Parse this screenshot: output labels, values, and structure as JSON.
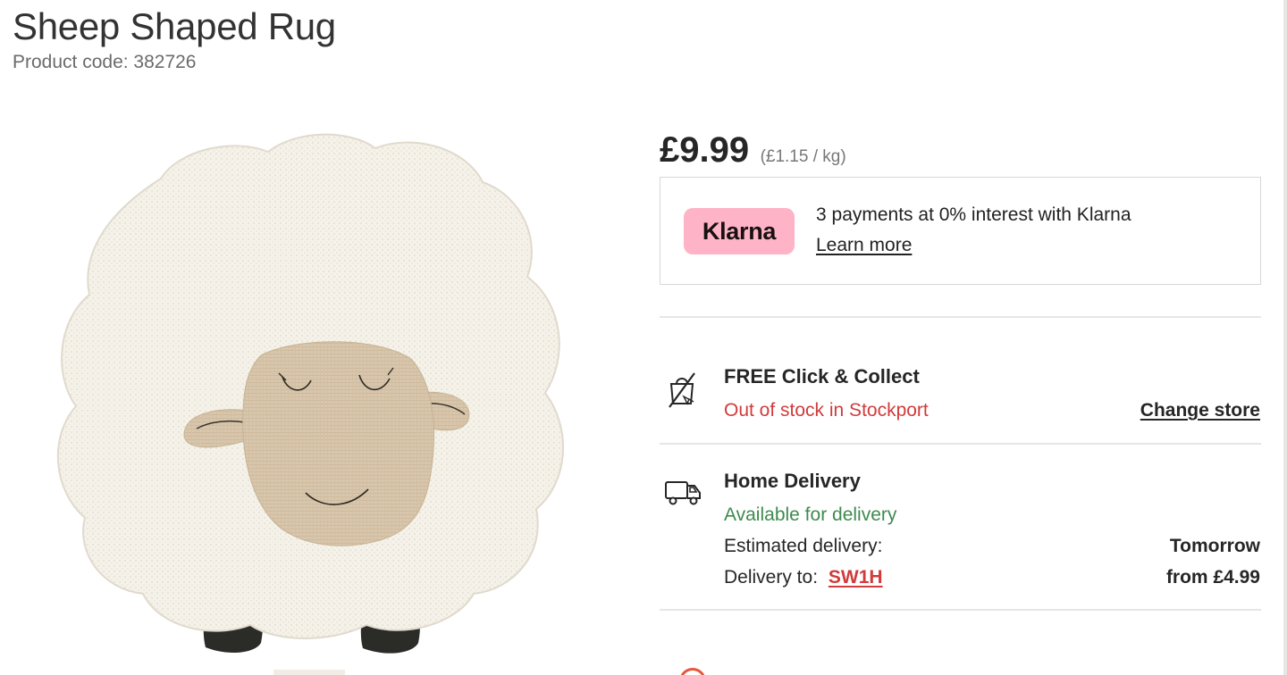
{
  "product": {
    "title": "Sheep Shaped Rug",
    "code_label": "Product code: 382726"
  },
  "pricing": {
    "price": "£9.99",
    "unit_price": "(£1.15 / kg)"
  },
  "klarna": {
    "badge": "Klarna",
    "text": "3 payments at 0% interest with Klarna",
    "link": "Learn more",
    "badge_color": "#ffb3c7"
  },
  "collect": {
    "icon": "no-bag-icon",
    "title": "FREE Click & Collect",
    "status": "Out of stock in Stockport",
    "change_store": "Change store"
  },
  "delivery": {
    "icon": "delivery-van-icon",
    "title": "Home Delivery",
    "status": "Available for delivery",
    "estimated_label": "Estimated delivery:",
    "estimated_value": "Tomorrow",
    "delivery_to_label": "Delivery to:",
    "postcode": "SW1H",
    "cost": "from £4.99"
  },
  "colors": {
    "error_red": "#d13b3b",
    "success_green": "#3f8a4f"
  }
}
